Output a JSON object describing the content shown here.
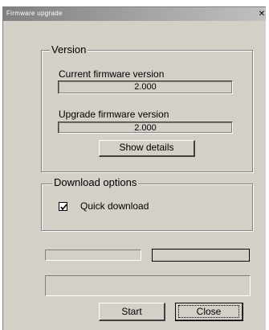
{
  "window": {
    "title": "Firmware upgrade",
    "close_glyph": "✕"
  },
  "version_group": {
    "legend": "Version",
    "current_label": "Current firmware version",
    "current_value": "2.000",
    "upgrade_label": "Upgrade firmware version",
    "upgrade_value": "2.000",
    "details_button": "Show details"
  },
  "download_group": {
    "legend": "Download options",
    "quick_download_label": "Quick download",
    "quick_download_checked": true
  },
  "progress": {
    "fraction": 0.0
  },
  "buttons": {
    "start": "Start",
    "close": "Close"
  }
}
